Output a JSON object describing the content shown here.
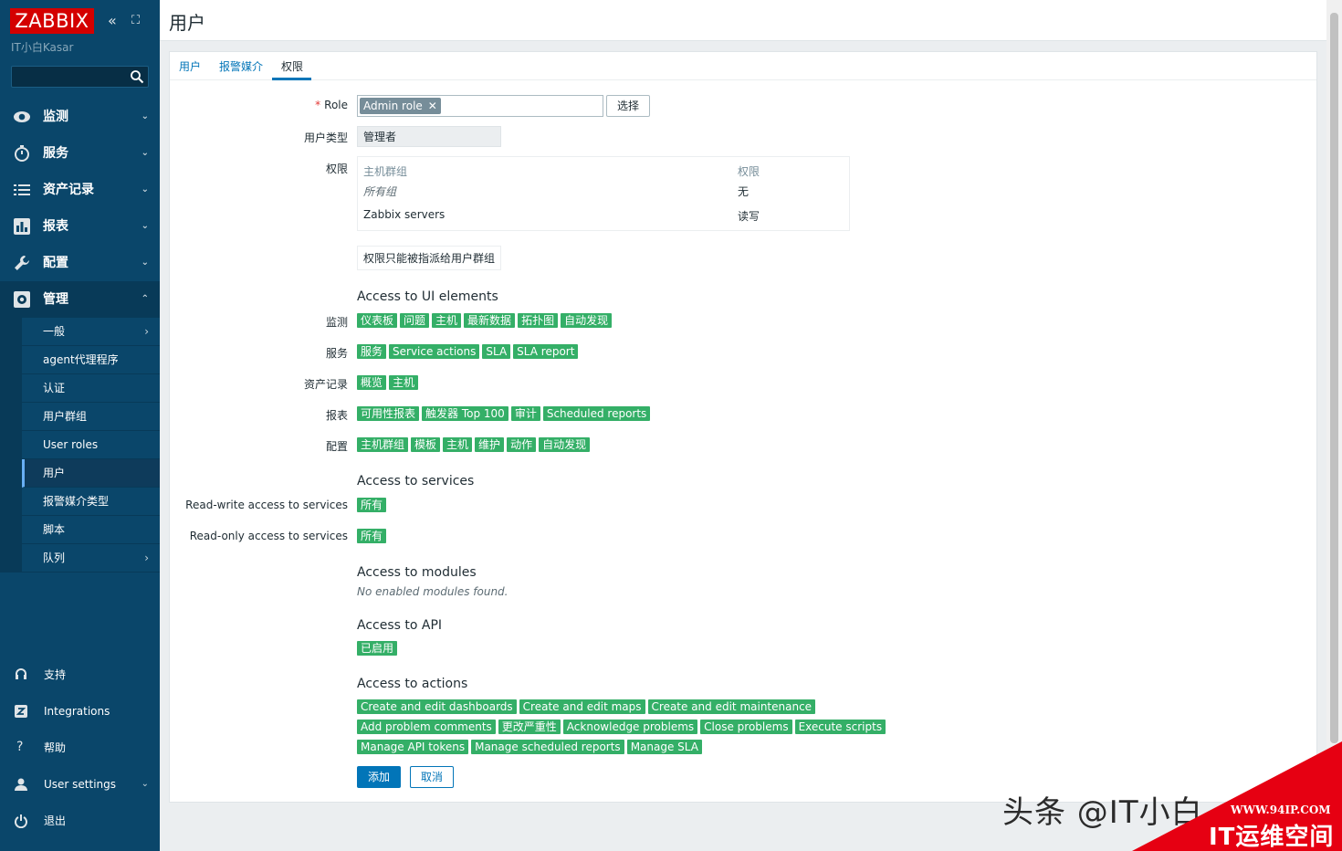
{
  "sidebar": {
    "logo": "ZABBIX",
    "server_name": "IT小白Kasar",
    "collapse_icon": "«",
    "kiosk_icon": "⛶",
    "menu": [
      {
        "label": "监测"
      },
      {
        "label": "服务"
      },
      {
        "label": "资产记录"
      },
      {
        "label": "报表"
      },
      {
        "label": "配置"
      },
      {
        "label": "管理"
      }
    ],
    "admin_submenu": [
      {
        "label": "一般"
      },
      {
        "label": "agent代理程序"
      },
      {
        "label": "认证"
      },
      {
        "label": "用户群组"
      },
      {
        "label": "User roles"
      },
      {
        "label": "用户"
      },
      {
        "label": "报警媒介类型"
      },
      {
        "label": "脚本"
      },
      {
        "label": "队列"
      }
    ],
    "bottom": [
      {
        "label": "支持"
      },
      {
        "label": "Integrations"
      },
      {
        "label": "帮助"
      },
      {
        "label": "User settings"
      },
      {
        "label": "退出"
      }
    ]
  },
  "header": {
    "title": "用户"
  },
  "tabs": [
    {
      "label": "用户"
    },
    {
      "label": "报警媒介"
    },
    {
      "label": "权限"
    }
  ],
  "form": {
    "role_label": "Role",
    "role_value": "Admin role",
    "select_button": "选择",
    "user_type_label": "用户类型",
    "user_type_value": "管理者",
    "permissions_label": "权限",
    "perm_headers": {
      "host_group": "主机群组",
      "permission": "权限"
    },
    "perm_rows": [
      {
        "group": "所有组",
        "permission": "无"
      },
      {
        "group": "Zabbix servers",
        "permission": "读写"
      }
    ],
    "perm_note": "权限只能被指派给用户群组",
    "ui_section": "Access to UI elements",
    "ui_rows": [
      {
        "label": "监测",
        "tags": [
          "仪表板",
          "问题",
          "主机",
          "最新数据",
          "拓扑图",
          "自动发现"
        ]
      },
      {
        "label": "服务",
        "tags": [
          "服务",
          "Service actions",
          "SLA",
          "SLA report"
        ]
      },
      {
        "label": "资产记录",
        "tags": [
          "概览",
          "主机"
        ]
      },
      {
        "label": "报表",
        "tags": [
          "可用性报表",
          "触发器 Top 100",
          "审计",
          "Scheduled reports"
        ]
      },
      {
        "label": "配置",
        "tags": [
          "主机群组",
          "模板",
          "主机",
          "维护",
          "动作",
          "自动发现"
        ]
      }
    ],
    "services_section": "Access to services",
    "services_rows": [
      {
        "label": "Read-write access to services",
        "tag": "所有"
      },
      {
        "label": "Read-only access to services",
        "tag": "所有"
      }
    ],
    "modules_section": "Access to modules",
    "modules_note": "No enabled modules found.",
    "api_section": "Access to API",
    "api_tag": "已启用",
    "actions_section": "Access to actions",
    "actions_rows": [
      [
        "Create and edit dashboards",
        "Create and edit maps",
        "Create and edit maintenance"
      ],
      [
        "Add problem comments",
        "更改严重性",
        "Acknowledge problems",
        "Close problems",
        "Execute scripts"
      ],
      [
        "Manage API tokens",
        "Manage scheduled reports",
        "Manage SLA"
      ]
    ],
    "add_button": "添加",
    "cancel_button": "取消"
  },
  "watermark": {
    "text": "头条 @IT小白",
    "url": "WWW.94IP.COM",
    "brand": "IT运维空间"
  },
  "colors": {
    "sidebar": "#0a466a",
    "accent": "#0275b8",
    "tag_green": "#34af67",
    "logo_red": "#d40000"
  }
}
